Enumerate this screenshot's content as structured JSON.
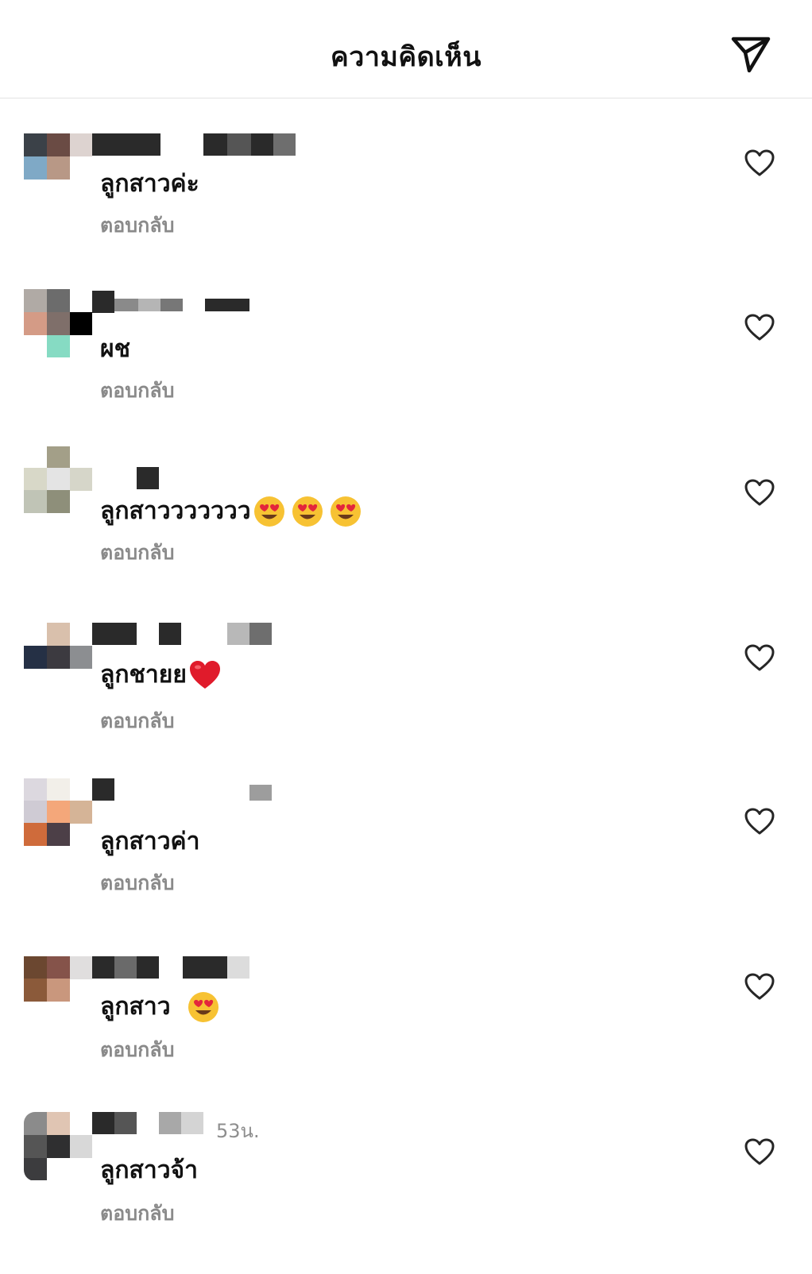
{
  "header": {
    "title": "ความคิดเห็น",
    "send_icon": "paper-plane-icon"
  },
  "comments": [
    {
      "text": "ลูกสาวค่ะ",
      "emoji": [],
      "reply_label": "ตอบกลับ",
      "time": "",
      "liked": false
    },
    {
      "text": "ผช",
      "emoji": [],
      "reply_label": "ตอบกลับ",
      "time": "",
      "liked": false
    },
    {
      "text": "ลูกสาววววววว",
      "emoji": [
        "heart-eyes",
        "heart-eyes",
        "heart-eyes"
      ],
      "reply_label": "ตอบกลับ",
      "time": "",
      "liked": false
    },
    {
      "text": "ลูกชายย",
      "emoji": [
        "red-heart"
      ],
      "reply_label": "ตอบกลับ",
      "time": "",
      "liked": false
    },
    {
      "text": "ลูกสาวค่า",
      "emoji": [],
      "reply_label": "ตอบกลับ",
      "time": "",
      "liked": false
    },
    {
      "text": "ลูกสาว ",
      "emoji": [
        "heart-eyes"
      ],
      "reply_label": "ตอบกลับ",
      "time": "",
      "liked": false
    },
    {
      "text": "ลูกสาวจ้า",
      "emoji": [],
      "reply_label": "ตอบกลับ",
      "time": "53น.",
      "liked": false
    }
  ],
  "colors": {
    "text": "#111111",
    "secondary": "#8a8a8a",
    "divider": "#e3e3e3"
  }
}
